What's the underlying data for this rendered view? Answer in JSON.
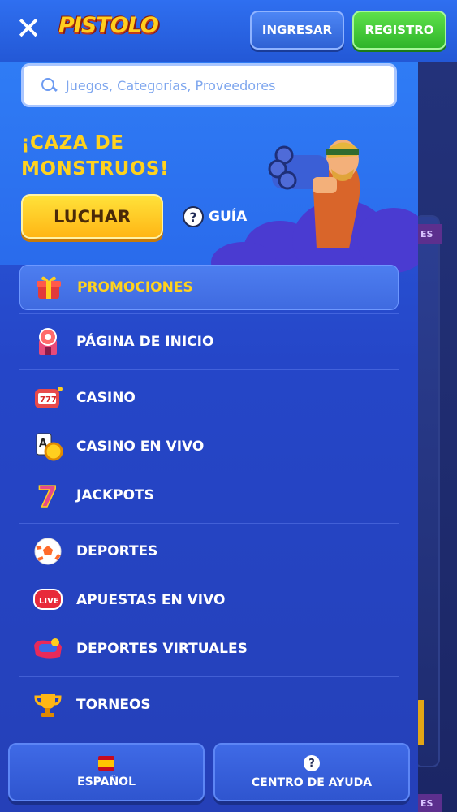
{
  "header": {
    "logo_text": "PISTOLO",
    "login_label": "INGRESAR",
    "register_label": "REGISTRO"
  },
  "search": {
    "placeholder": "Juegos, Categorías, Proveedores"
  },
  "promo": {
    "title_line1": "¡CAZA DE",
    "title_line2": "MONSTRUOS!",
    "cta_label": "LUCHAR",
    "guide_label": "GUÍA"
  },
  "menu": {
    "items": [
      {
        "label": "PROMOCIONES",
        "icon": "gift-icon"
      },
      {
        "label": "PÁGINA DE INICIO",
        "icon": "home-icon"
      },
      {
        "label": "CASINO",
        "icon": "slot-machine-icon"
      },
      {
        "label": "CASINO EN VIVO",
        "icon": "cards-chip-icon"
      },
      {
        "label": "JACKPOTS",
        "icon": "seven-icon"
      },
      {
        "label": "DEPORTES",
        "icon": "soccer-ball-icon"
      },
      {
        "label": "APUESTAS EN VIVO",
        "icon": "live-icon"
      },
      {
        "label": "DEPORTES VIRTUALES",
        "icon": "vr-headset-icon"
      },
      {
        "label": "TORNEOS",
        "icon": "trophy-icon"
      }
    ]
  },
  "background": {
    "tag_label": "ES"
  },
  "footer": {
    "language_label": "ESPAÑOL",
    "help_label": "CENTRO DE AYUDA",
    "help_icon": "?"
  },
  "colors": {
    "accent_yellow": "#ffd21e",
    "header_blue": "#2f6ff0",
    "register_green": "#2fb52a"
  }
}
